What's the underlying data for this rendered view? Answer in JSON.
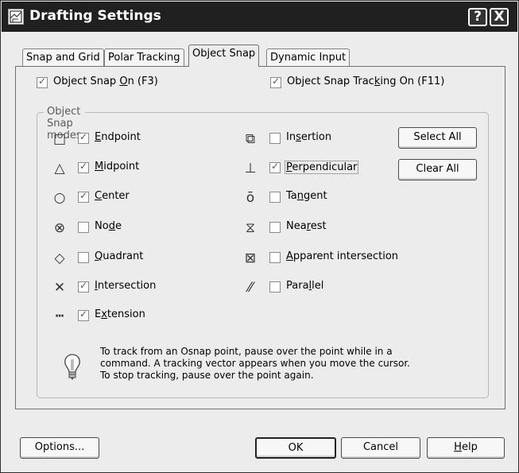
{
  "window": {
    "title": "Drafting Settings",
    "help_button": "?",
    "close_button": "X"
  },
  "tabs": [
    "Snap and Grid",
    "Polar Tracking",
    "Object Snap",
    "Dynamic Input"
  ],
  "active_tab": "Object Snap",
  "top_options": {
    "object_snap_on": {
      "label_pre": "Object Snap ",
      "label_ul": "O",
      "label_post": "n (F3)",
      "checked": true
    },
    "tracking_on": {
      "label_pre": "Object Snap Trac",
      "label_ul": "k",
      "label_post": "ing On (F11)",
      "checked": true
    }
  },
  "group_title": "Object Snap modes",
  "snap_modes_left": [
    {
      "icon": "endpoint-icon",
      "pre": "",
      "ul": "E",
      "post": "ndpoint",
      "checked": true
    },
    {
      "icon": "midpoint-icon",
      "pre": "",
      "ul": "M",
      "post": "idpoint",
      "checked": true
    },
    {
      "icon": "center-icon",
      "pre": "",
      "ul": "C",
      "post": "enter",
      "checked": true
    },
    {
      "icon": "node-icon",
      "pre": "No",
      "ul": "d",
      "post": "e",
      "checked": false
    },
    {
      "icon": "quadrant-icon",
      "pre": "",
      "ul": "Q",
      "post": "uadrant",
      "checked": false
    },
    {
      "icon": "intersection-icon",
      "pre": "",
      "ul": "I",
      "post": "ntersection",
      "checked": true
    },
    {
      "icon": "extension-icon",
      "pre": "E",
      "ul": "x",
      "post": "tension",
      "checked": true
    }
  ],
  "snap_modes_right": [
    {
      "icon": "insertion-icon",
      "pre": "In",
      "ul": "s",
      "post": "ertion",
      "checked": false
    },
    {
      "icon": "perpendicular-icon",
      "pre": "",
      "ul": "P",
      "post": "erpendicular",
      "checked": true
    },
    {
      "icon": "tangent-icon",
      "pre": "Ta",
      "ul": "n",
      "post": "gent",
      "checked": false
    },
    {
      "icon": "nearest-icon",
      "pre": "Nea",
      "ul": "r",
      "post": "est",
      "checked": false
    },
    {
      "icon": "apparent-intersection-icon",
      "pre": "",
      "ul": "A",
      "post": "pparent intersection",
      "checked": false
    },
    {
      "icon": "parallel-icon",
      "pre": "Para",
      "ul": "l",
      "post": "lel",
      "checked": false
    }
  ],
  "buttons": {
    "select_all": "Select All",
    "clear_all": "Clear All",
    "options": "Options...",
    "ok": "OK",
    "cancel": "Cancel",
    "help_ul": "H",
    "help_post": "elp"
  },
  "tip": {
    "icon": "lightbulb-icon",
    "lines": [
      "To track from an Osnap point, pause over the point while in a",
      "command.  A tracking vector appears when you move the cursor.",
      "To stop tracking, pause over the point again."
    ]
  }
}
